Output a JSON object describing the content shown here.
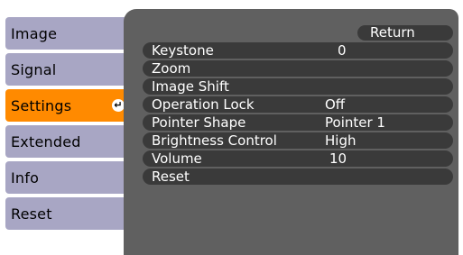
{
  "menu": {
    "items": [
      {
        "label": "Image"
      },
      {
        "label": "Signal"
      },
      {
        "label": "Settings",
        "selected": true
      },
      {
        "label": "Extended"
      },
      {
        "label": "Info"
      },
      {
        "label": "Reset"
      }
    ],
    "enter_icon": "enter-icon",
    "selected_color": "#ff8a00",
    "item_color": "#a8a6c4"
  },
  "panel": {
    "return_label": "Return",
    "rows": [
      {
        "label": "Keystone",
        "value": "0"
      },
      {
        "label": "Zoom",
        "value": ""
      },
      {
        "label": "Image Shift",
        "value": ""
      },
      {
        "label": "Operation Lock",
        "value": "Off"
      },
      {
        "label": "Pointer Shape",
        "value": "Pointer 1"
      },
      {
        "label": "Brightness Control",
        "value": "High"
      },
      {
        "label": "Volume",
        "value": "10"
      },
      {
        "label": "Reset",
        "value": ""
      }
    ],
    "background_color": "#606060",
    "row_color": "#3a3a3a"
  }
}
